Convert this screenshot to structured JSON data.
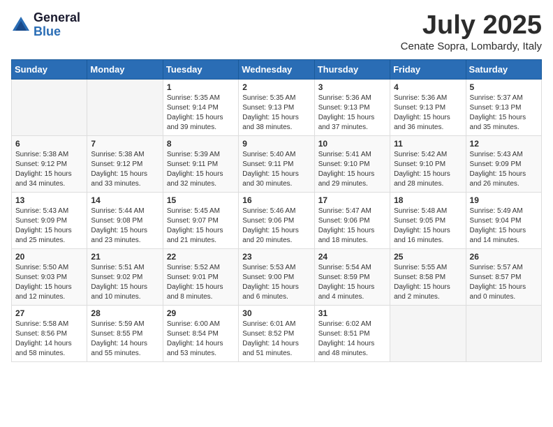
{
  "header": {
    "logo_general": "General",
    "logo_blue": "Blue",
    "month_year": "July 2025",
    "location": "Cenate Sopra, Lombardy, Italy"
  },
  "days_of_week": [
    "Sunday",
    "Monday",
    "Tuesday",
    "Wednesday",
    "Thursday",
    "Friday",
    "Saturday"
  ],
  "weeks": [
    [
      {
        "day": "",
        "content": ""
      },
      {
        "day": "",
        "content": ""
      },
      {
        "day": "1",
        "content": "Sunrise: 5:35 AM\nSunset: 9:14 PM\nDaylight: 15 hours and 39 minutes."
      },
      {
        "day": "2",
        "content": "Sunrise: 5:35 AM\nSunset: 9:13 PM\nDaylight: 15 hours and 38 minutes."
      },
      {
        "day": "3",
        "content": "Sunrise: 5:36 AM\nSunset: 9:13 PM\nDaylight: 15 hours and 37 minutes."
      },
      {
        "day": "4",
        "content": "Sunrise: 5:36 AM\nSunset: 9:13 PM\nDaylight: 15 hours and 36 minutes."
      },
      {
        "day": "5",
        "content": "Sunrise: 5:37 AM\nSunset: 9:13 PM\nDaylight: 15 hours and 35 minutes."
      }
    ],
    [
      {
        "day": "6",
        "content": "Sunrise: 5:38 AM\nSunset: 9:12 PM\nDaylight: 15 hours and 34 minutes."
      },
      {
        "day": "7",
        "content": "Sunrise: 5:38 AM\nSunset: 9:12 PM\nDaylight: 15 hours and 33 minutes."
      },
      {
        "day": "8",
        "content": "Sunrise: 5:39 AM\nSunset: 9:11 PM\nDaylight: 15 hours and 32 minutes."
      },
      {
        "day": "9",
        "content": "Sunrise: 5:40 AM\nSunset: 9:11 PM\nDaylight: 15 hours and 30 minutes."
      },
      {
        "day": "10",
        "content": "Sunrise: 5:41 AM\nSunset: 9:10 PM\nDaylight: 15 hours and 29 minutes."
      },
      {
        "day": "11",
        "content": "Sunrise: 5:42 AM\nSunset: 9:10 PM\nDaylight: 15 hours and 28 minutes."
      },
      {
        "day": "12",
        "content": "Sunrise: 5:43 AM\nSunset: 9:09 PM\nDaylight: 15 hours and 26 minutes."
      }
    ],
    [
      {
        "day": "13",
        "content": "Sunrise: 5:43 AM\nSunset: 9:09 PM\nDaylight: 15 hours and 25 minutes."
      },
      {
        "day": "14",
        "content": "Sunrise: 5:44 AM\nSunset: 9:08 PM\nDaylight: 15 hours and 23 minutes."
      },
      {
        "day": "15",
        "content": "Sunrise: 5:45 AM\nSunset: 9:07 PM\nDaylight: 15 hours and 21 minutes."
      },
      {
        "day": "16",
        "content": "Sunrise: 5:46 AM\nSunset: 9:06 PM\nDaylight: 15 hours and 20 minutes."
      },
      {
        "day": "17",
        "content": "Sunrise: 5:47 AM\nSunset: 9:06 PM\nDaylight: 15 hours and 18 minutes."
      },
      {
        "day": "18",
        "content": "Sunrise: 5:48 AM\nSunset: 9:05 PM\nDaylight: 15 hours and 16 minutes."
      },
      {
        "day": "19",
        "content": "Sunrise: 5:49 AM\nSunset: 9:04 PM\nDaylight: 15 hours and 14 minutes."
      }
    ],
    [
      {
        "day": "20",
        "content": "Sunrise: 5:50 AM\nSunset: 9:03 PM\nDaylight: 15 hours and 12 minutes."
      },
      {
        "day": "21",
        "content": "Sunrise: 5:51 AM\nSunset: 9:02 PM\nDaylight: 15 hours and 10 minutes."
      },
      {
        "day": "22",
        "content": "Sunrise: 5:52 AM\nSunset: 9:01 PM\nDaylight: 15 hours and 8 minutes."
      },
      {
        "day": "23",
        "content": "Sunrise: 5:53 AM\nSunset: 9:00 PM\nDaylight: 15 hours and 6 minutes."
      },
      {
        "day": "24",
        "content": "Sunrise: 5:54 AM\nSunset: 8:59 PM\nDaylight: 15 hours and 4 minutes."
      },
      {
        "day": "25",
        "content": "Sunrise: 5:55 AM\nSunset: 8:58 PM\nDaylight: 15 hours and 2 minutes."
      },
      {
        "day": "26",
        "content": "Sunrise: 5:57 AM\nSunset: 8:57 PM\nDaylight: 15 hours and 0 minutes."
      }
    ],
    [
      {
        "day": "27",
        "content": "Sunrise: 5:58 AM\nSunset: 8:56 PM\nDaylight: 14 hours and 58 minutes."
      },
      {
        "day": "28",
        "content": "Sunrise: 5:59 AM\nSunset: 8:55 PM\nDaylight: 14 hours and 55 minutes."
      },
      {
        "day": "29",
        "content": "Sunrise: 6:00 AM\nSunset: 8:54 PM\nDaylight: 14 hours and 53 minutes."
      },
      {
        "day": "30",
        "content": "Sunrise: 6:01 AM\nSunset: 8:52 PM\nDaylight: 14 hours and 51 minutes."
      },
      {
        "day": "31",
        "content": "Sunrise: 6:02 AM\nSunset: 8:51 PM\nDaylight: 14 hours and 48 minutes."
      },
      {
        "day": "",
        "content": ""
      },
      {
        "day": "",
        "content": ""
      }
    ]
  ]
}
